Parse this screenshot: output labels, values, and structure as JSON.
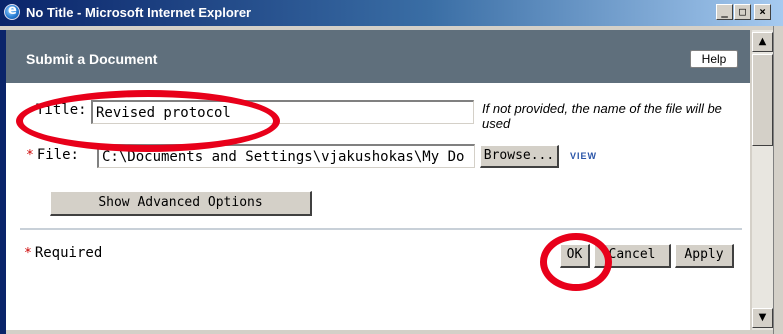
{
  "window": {
    "title": "No Title - Microsoft Internet Explorer",
    "controls": {
      "minimize": "_",
      "maximize": "□",
      "close": "×"
    },
    "app_icon": "ie-icon"
  },
  "dialog": {
    "heading": "Submit a Document",
    "help_label": "Help",
    "title_field": {
      "label": "Title:",
      "value": "Revised protocol",
      "hint": "If not provided, the name of the file will be used"
    },
    "file_field": {
      "required_mark": "*",
      "label": "File:",
      "value": "C:\\Documents and Settings\\vjakushokas\\My Do",
      "browse_label": "Browse...",
      "view_label": "VIEW"
    },
    "advanced_label": "Show Advanced Options",
    "required_note": {
      "mark": "*",
      "text": "Required"
    },
    "buttons": {
      "ok": "OK",
      "cancel": "Cancel",
      "apply": "Apply"
    }
  },
  "annotations": {
    "highlight_color": "#e8001a"
  },
  "colors": {
    "banner": "#5f6f7c",
    "titlebar": "#0a246a",
    "required": "#cc0000"
  }
}
